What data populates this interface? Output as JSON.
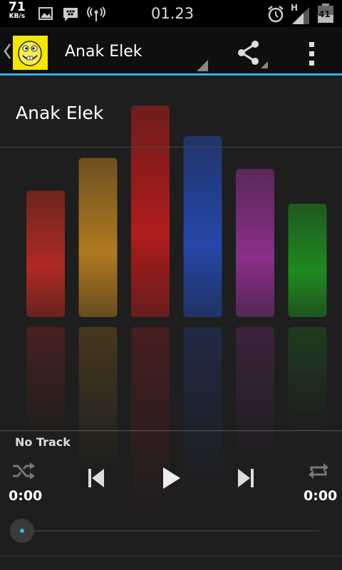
{
  "status_bar": {
    "speed_value": "71",
    "speed_unit": "KB/s",
    "time": "01.23",
    "network_type": "H",
    "battery_level": "41",
    "icons": [
      "gallery-icon",
      "bbm-icon",
      "wireless-icon",
      "alarm-icon",
      "signal-icon",
      "battery-icon"
    ]
  },
  "action_bar": {
    "title": "Anak Elek",
    "accent_color": "#33b5e5"
  },
  "visualizer": {
    "song_title": "Anak Elek",
    "levels": [
      0.58,
      0.73,
      0.97,
      0.83,
      0.68,
      0.52
    ],
    "colors": [
      "#b02a22",
      "#b07a20",
      "#b01c1c",
      "#2447a8",
      "#8a2f8a",
      "#1f8a1f"
    ]
  },
  "player": {
    "track_label": "No Track",
    "elapsed": "0:00",
    "duration": "0:00",
    "progress": 0
  }
}
